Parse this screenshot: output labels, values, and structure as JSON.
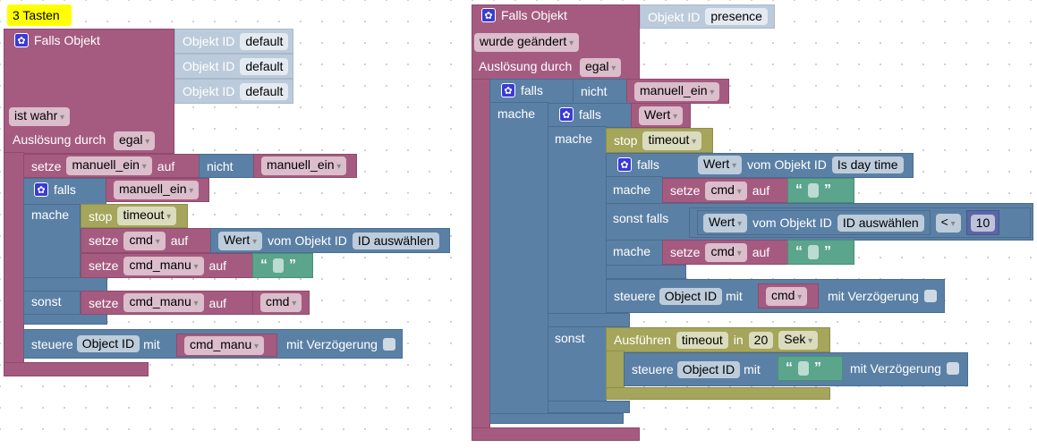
{
  "left": {
    "comment": "3 Tasten",
    "event_title": "Falls Objekt",
    "object_id_label": "Objekt ID",
    "object_ids": [
      "default",
      "default",
      "default"
    ],
    "condition": "ist wahr",
    "trigger_label": "Auslösung durch",
    "trigger_value": "egal",
    "set1": {
      "setze": "setze",
      "var": "manuell_ein",
      "auf": "auf",
      "nicht": "nicht",
      "value": "manuell_ein"
    },
    "if": {
      "falls": "falls",
      "cond": "manuell_ein",
      "mache": "mache",
      "sonst": "sonst"
    },
    "stop": {
      "label": "stop",
      "value": "timeout"
    },
    "set2": {
      "setze": "setze",
      "var": "cmd",
      "auf": "auf",
      "mode": "Wert",
      "vom": "vom Objekt ID",
      "id": "ID auswählen"
    },
    "set3": {
      "setze": "setze",
      "var": "cmd_manu",
      "auf": "auf"
    },
    "set4": {
      "setze": "setze",
      "var": "cmd_manu",
      "auf": "auf",
      "value": "cmd"
    },
    "control": {
      "label": "steuere",
      "target": "Object ID",
      "mit": "mit",
      "value": "cmd_manu",
      "delay": "mit Verzögerung"
    }
  },
  "right": {
    "event_title": "Falls Objekt",
    "object_id_label": "Objekt ID",
    "object_id": "presence",
    "condition": "wurde geändert",
    "trigger_label": "Auslösung durch",
    "trigger_value": "egal",
    "if1": {
      "falls": "falls",
      "nicht": "nicht",
      "cond": "manuell_ein",
      "mache": "mache"
    },
    "if2": {
      "falls": "falls",
      "cond": "Wert",
      "mache": "mache",
      "sonst": "sonst"
    },
    "stop": {
      "label": "stop",
      "value": "timeout"
    },
    "if3": {
      "falls": "falls",
      "mode": "Wert",
      "vom": "vom Objekt ID",
      "id": "Is day time",
      "mache": "mache",
      "sonst_falls": "sonst falls",
      "mache2": "mache"
    },
    "set_a": {
      "setze": "setze",
      "var": "cmd",
      "auf": "auf"
    },
    "compare": {
      "mode": "Wert",
      "vom": "vom Objekt ID",
      "id": "ID auswählen",
      "op": "<",
      "num": "10"
    },
    "set_b": {
      "setze": "setze",
      "var": "cmd",
      "auf": "auf"
    },
    "control1": {
      "label": "steuere",
      "target": "Object ID",
      "mit": "mit",
      "value": "cmd",
      "delay": "mit Verzögerung"
    },
    "run": {
      "label": "Ausführen",
      "name": "timeout",
      "in": "in",
      "time": "20",
      "unit": "Sek"
    },
    "control2": {
      "label": "steuere",
      "target": "Object ID",
      "mit": "mit",
      "delay": "mit Verzögerung"
    }
  },
  "colors": {
    "event": "#a55b80",
    "logic": "#5b80a5",
    "timer": "#a5a55b",
    "text": "#5ba58c",
    "math": "#5b67a5",
    "object": "#bccbdb",
    "comment": "#ffff00"
  }
}
